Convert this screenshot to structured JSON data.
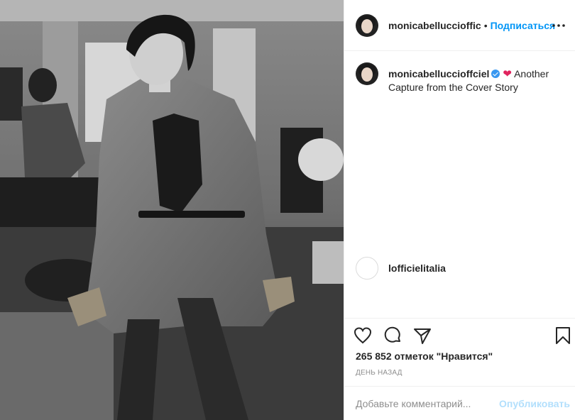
{
  "post": {
    "header": {
      "username": "monicabelluccioffic",
      "separator": "•",
      "follow_label": "Подписаться",
      "more_icon": "more-horizontal-icon"
    },
    "caption": {
      "username": "monicabelluccioffciel",
      "emoji": "❤",
      "text": "Another Capture from the Cover Story"
    },
    "partial_comment": {
      "username": "lofficielitalia"
    },
    "actions": {
      "like_icon": "heart-icon",
      "comment_icon": "comment-icon",
      "share_icon": "share-icon",
      "save_icon": "bookmark-icon"
    },
    "likes_text": "265 852 отметок \"Нравится\"",
    "time_text": "день назад",
    "add_comment": {
      "placeholder": "Добавьте комментарий...",
      "publish_label": "Опубликовать"
    }
  }
}
